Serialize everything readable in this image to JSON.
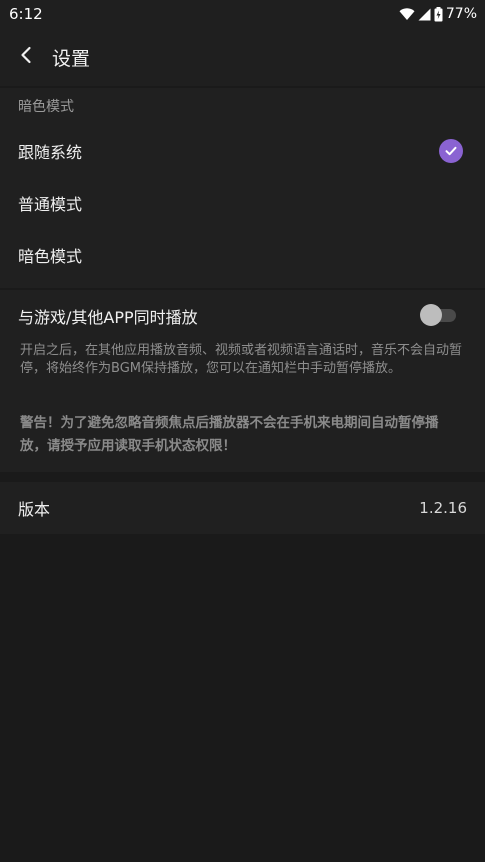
{
  "status_bar": {
    "time": "6:12",
    "battery_percent": "77%",
    "icons": [
      "wifi-icon",
      "signal-icon",
      "battery-icon"
    ]
  },
  "app_bar": {
    "title": "设置",
    "back_icon": "chevron-left-icon"
  },
  "theme_section": {
    "header": "暗色模式",
    "options": [
      {
        "label": "跟随系统",
        "selected": true
      },
      {
        "label": "普通模式",
        "selected": false
      },
      {
        "label": "暗色模式",
        "selected": false
      }
    ],
    "check_icon": "check-circle-icon"
  },
  "game_section": {
    "title": "与游戏/其他APP同时播放",
    "toggle_on": false,
    "description": "开启之后，在其他应用播放音频、视频或者视频语言通话时，音乐不会自动暂停，将始终作为BGM保持播放，您可以在通知栏中手动暂停播放。",
    "warning": "警告！为了避免忽略音频焦点后播放器不会在手机来电期间自动暂停播放，请授予应用读取手机状态权限！"
  },
  "version_section": {
    "label": "版本",
    "value": "1.2.16"
  },
  "colors": {
    "background": "#1a1a1a",
    "surface": "#202020",
    "accent": "#8a63d2",
    "text_primary": "#f0f0f0",
    "text_secondary": "#8e8e8e"
  }
}
